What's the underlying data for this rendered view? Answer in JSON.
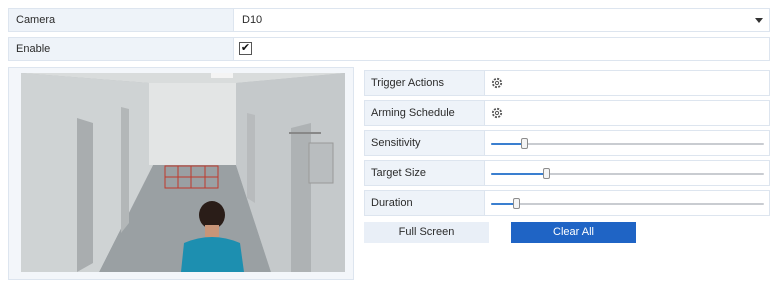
{
  "camera": {
    "label": "Camera",
    "value": "D10"
  },
  "enable": {
    "label": "Enable",
    "checked": true,
    "check_glyph": "✔"
  },
  "preview": {
    "alt_icon": "camera-preview-image"
  },
  "settings": {
    "trigger_actions": {
      "label": "Trigger Actions",
      "icon": "gear-icon"
    },
    "arming_schedule": {
      "label": "Arming Schedule",
      "icon": "gear-icon"
    },
    "sensitivity": {
      "label": "Sensitivity",
      "level": 0.12
    },
    "target_size": {
      "label": "Target Size",
      "level": 0.2
    },
    "duration": {
      "label": "Duration",
      "level": 0.09
    }
  },
  "buttons": {
    "full_screen": "Full Screen",
    "clear_all": "Clear All"
  },
  "colors": {
    "accent": "#1f64c5",
    "slider_fill": "#3a7fd0",
    "label_bg": "#eef3f9"
  }
}
